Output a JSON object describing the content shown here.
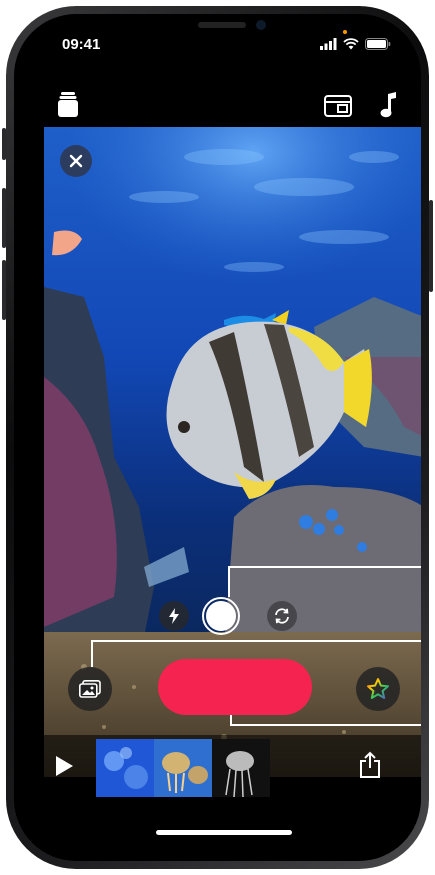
{
  "status_bar": {
    "time": "09:41"
  },
  "toolbar": {
    "projects_icon": "stack-icon",
    "aspect_icon": "aspect-ratio-icon",
    "music_icon": "music-note-icon"
  },
  "camera": {
    "close_icon": "close-icon",
    "flash_icon": "flash-icon",
    "flip_icon": "camera-flip-icon",
    "media_icon": "media-library-icon",
    "effects_icon": "star-effects-icon"
  },
  "timeline": {
    "play_icon": "play-icon",
    "share_icon": "share-icon",
    "clips": [
      "clip-1",
      "clip-2",
      "clip-3"
    ]
  },
  "colors": {
    "record": "#f5234f",
    "accent": "#ffffff"
  }
}
